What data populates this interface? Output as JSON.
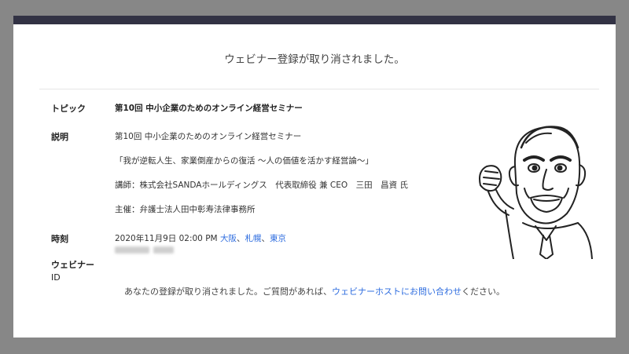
{
  "header": {
    "title": "ウェビナー登録が取り消されました。"
  },
  "details": {
    "topic_label": "トピック",
    "topic_value": "第10回 中小企業のためのオンライン経営セミナー",
    "description_label": "説明",
    "description_lines": [
      "第10回 中小企業のためのオンライン経営セミナー",
      "「我が逆転人生、家業倒産からの復活 ～人の価値を活かす経営論～」",
      "講師：株式会社SANDAホールディングス　代表取締役 兼 CEO　三田　昌資 氏",
      "主催：弁護士法人田中彰寿法律事務所"
    ],
    "time_label": "時刻",
    "time_value": "2020年11月9日 02:00 PM",
    "time_zone_links": [
      "大阪",
      "札幌",
      "東京"
    ],
    "time_zone_separator": "、",
    "webinar_id_label_line1": "ウェビナー",
    "webinar_id_label_line2": "ID"
  },
  "footer": {
    "text_before": "あなたの登録が取り消されました。ご質問があれば、",
    "link": "ウェビナーホストにお問い合わせ",
    "text_after": "ください。"
  },
  "colors": {
    "page_background": "#878787",
    "top_bar": "#323244",
    "link": "#2d6cdf"
  },
  "icons": {
    "caricature": "presenter-caricature-illustration"
  }
}
